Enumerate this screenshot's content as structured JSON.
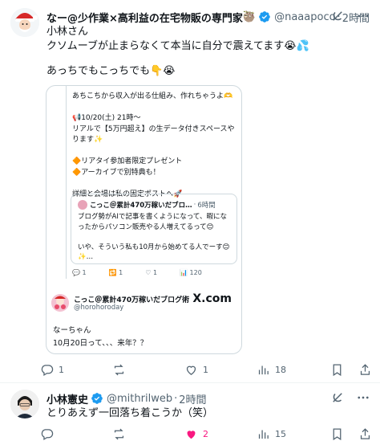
{
  "colors": {
    "verified": "#1d9bf0",
    "muted": "#536471",
    "like": "#f91880",
    "text": "#0f1419"
  },
  "post1": {
    "name": "なー@少作業×高利益の在宅物販の専門家",
    "name_emoji": "🦥",
    "handle": "@naaapoco",
    "dot": "·",
    "time": "2時間",
    "text_line1": "小林さん",
    "text_line2": "クソムーブが止まらなくて本当に自分で震えてます😭💦",
    "text_line3": "あっちでもこっちでも👇😭",
    "quote": {
      "text": "あちこちから収入が出る仕組み、作れちゃうよ🫶\n\n📢10/20(土) 21時〜\nリアルで【5万円超え】の生データ付きスペースやります✨\n\n🔶リアタイ参加者限定プレゼント\n🔶アーカイブで別特典も！\n\n詳細と会場は私の固定ポストへ🚀",
      "nested": {
        "name": "こっこ＠累計470万稼いだブロ…",
        "dot": "·",
        "time": "6時間",
        "text": "ブログ勢がAIで記事を書くようになって、暇になったからパソコン販売やる人増えてるって😊\n\nいや、そういう私も10月から始めてる人でーす😊✨…"
      },
      "actions": {
        "reply": "1",
        "retweet": "1",
        "like": "1",
        "views": "120"
      },
      "card": {
        "name": "こっこ＠累計470万稼いだブログ術",
        "handle": "@horohoroday",
        "brand": "X.com",
        "text": "なーちゃん\n10月20日って、、、来年？？"
      }
    },
    "actions": {
      "reply": "1",
      "retweet": "",
      "like": "1",
      "views": "18"
    }
  },
  "post2": {
    "name": "小林憲史",
    "handle": "@mithrilweb",
    "dot": "·",
    "time": "2時間",
    "text": "とりあえず一回落ち着こうか（笑）",
    "actions": {
      "reply": "",
      "retweet": "",
      "like": "2",
      "views": "15"
    }
  }
}
